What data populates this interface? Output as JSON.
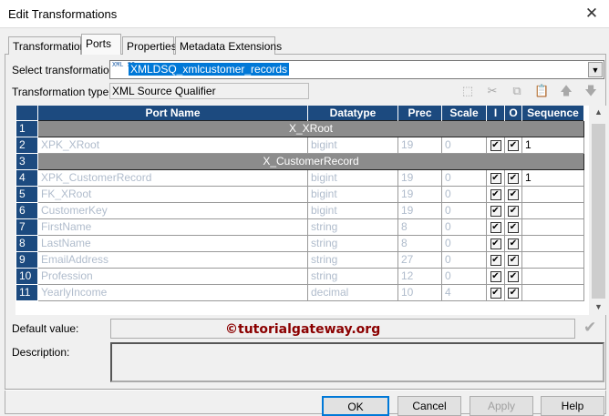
{
  "window": {
    "title": "Edit Transformations",
    "close": "✕"
  },
  "tabs": [
    {
      "label": "Transformation"
    },
    {
      "label": "Ports"
    },
    {
      "label": "Properties"
    },
    {
      "label": "Metadata Extensions"
    }
  ],
  "form": {
    "select_label": "Select transformation:",
    "select_icon": "XML SQ",
    "select_value": "XMLDSQ_xmlcustomer_records",
    "type_label": "Transformation type:",
    "type_value": "XML Source Qualifier",
    "default_label": "Default value:",
    "default_value": "",
    "description_label": "Description:",
    "description_value": "",
    "watermark": "©tutorialgateway.org"
  },
  "toolbar": [
    {
      "icon": "new-port-icon",
      "glyph": "⬚"
    },
    {
      "icon": "cut-icon",
      "glyph": "✂"
    },
    {
      "icon": "copy-icon",
      "glyph": "⧉"
    },
    {
      "icon": "paste-icon",
      "glyph": "📋"
    },
    {
      "icon": "move-up-icon",
      "glyph": "🡅"
    },
    {
      "icon": "move-down-icon",
      "glyph": "🡇"
    }
  ],
  "grid": {
    "headers": [
      "",
      "Port Name",
      "Datatype",
      "Prec",
      "Scale",
      "I",
      "O",
      "Sequence"
    ],
    "rows": [
      {
        "n": "1",
        "group": "X_XRoot"
      },
      {
        "n": "2",
        "name": "XPK_XRoot",
        "type": "bigint",
        "prec": "19",
        "scale": "0",
        "i": true,
        "o": true,
        "seq": "1"
      },
      {
        "n": "3",
        "group": "X_CustomerRecord"
      },
      {
        "n": "4",
        "name": "XPK_CustomerRecord",
        "type": "bigint",
        "prec": "19",
        "scale": "0",
        "i": true,
        "o": true,
        "seq": "1"
      },
      {
        "n": "5",
        "name": "FK_XRoot",
        "type": "bigint",
        "prec": "19",
        "scale": "0",
        "i": true,
        "o": true,
        "seq": ""
      },
      {
        "n": "6",
        "name": "CustomerKey",
        "type": "bigint",
        "prec": "19",
        "scale": "0",
        "i": true,
        "o": true,
        "seq": ""
      },
      {
        "n": "7",
        "name": "FirstName",
        "type": "string",
        "prec": "8",
        "scale": "0",
        "i": true,
        "o": true,
        "seq": ""
      },
      {
        "n": "8",
        "name": "LastName",
        "type": "string",
        "prec": "8",
        "scale": "0",
        "i": true,
        "o": true,
        "seq": ""
      },
      {
        "n": "9",
        "name": "EmailAddress",
        "type": "string",
        "prec": "27",
        "scale": "0",
        "i": true,
        "o": true,
        "seq": ""
      },
      {
        "n": "10",
        "name": "Profession",
        "type": "string",
        "prec": "12",
        "scale": "0",
        "i": true,
        "o": true,
        "seq": ""
      },
      {
        "n": "11",
        "name": "YearlyIncome",
        "type": "decimal",
        "prec": "10",
        "scale": "4",
        "i": true,
        "o": true,
        "seq": ""
      }
    ]
  },
  "buttons": {
    "ok": "OK",
    "cancel": "Cancel",
    "apply": "Apply",
    "help": "Help"
  }
}
